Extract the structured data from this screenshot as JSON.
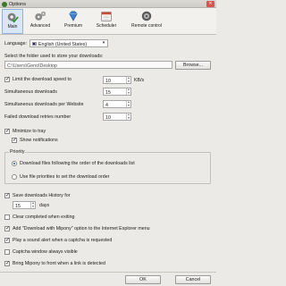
{
  "window": {
    "title": "Options",
    "close_glyph": "✕"
  },
  "toolbar": {
    "tabs": [
      {
        "label": "Main",
        "icon": "gear-check-icon",
        "active": true
      },
      {
        "label": "Advanced",
        "icon": "gears-icon",
        "active": false
      },
      {
        "label": "Premium",
        "icon": "diamond-icon",
        "active": false
      },
      {
        "label": "Scheduler",
        "icon": "calendar-icon",
        "active": false
      },
      {
        "label": "Remote control",
        "icon": "remote-control-icon",
        "active": false
      }
    ]
  },
  "language": {
    "label": "Language:",
    "value": "English (United States)"
  },
  "download_folder": {
    "label": "Select the folder used to store your downloads:",
    "value": "C:\\Users\\Geno\\Desktop",
    "browse_label": "Browse..."
  },
  "speed": {
    "label": "Limit the download speed to",
    "checked": true,
    "value": "10",
    "unit": "KB/s"
  },
  "simultaneous": {
    "label": "Simultaneous downloads",
    "value": "15"
  },
  "per_website": {
    "label": "Simultaneous downloads per Website",
    "value": "4"
  },
  "retries": {
    "label": "Failed download retries number",
    "value": "10"
  },
  "tray": {
    "label": "Minimize to tray",
    "checked": true
  },
  "notifications": {
    "label": "Show notifications",
    "checked": true
  },
  "priority": {
    "legend": "Priority",
    "options": [
      {
        "label": "Download files following the order of the downloads list",
        "selected": true
      },
      {
        "label": "Use file priorities to set the download order",
        "selected": false
      }
    ]
  },
  "history": {
    "label": "Save downloads History for",
    "checked": true,
    "value": "15",
    "unit": "days"
  },
  "options": [
    {
      "label": "Clear completed when exiting",
      "checked": false
    },
    {
      "label": "Add \"Download with Mipony\" option to the Internet Explorer menu",
      "checked": true
    },
    {
      "label": "Play a sound alert when a captcha is requested",
      "checked": true
    },
    {
      "label": "Captcha window always visible",
      "checked": false
    },
    {
      "label": "Bring Mipony to front when a link is detected",
      "checked": true
    }
  ],
  "footer": {
    "ok_label": "OK",
    "cancel_label": "Cancel"
  },
  "colors": {
    "accent": "#1f5fb8",
    "active_tab_bg": "#d9e6f5"
  }
}
